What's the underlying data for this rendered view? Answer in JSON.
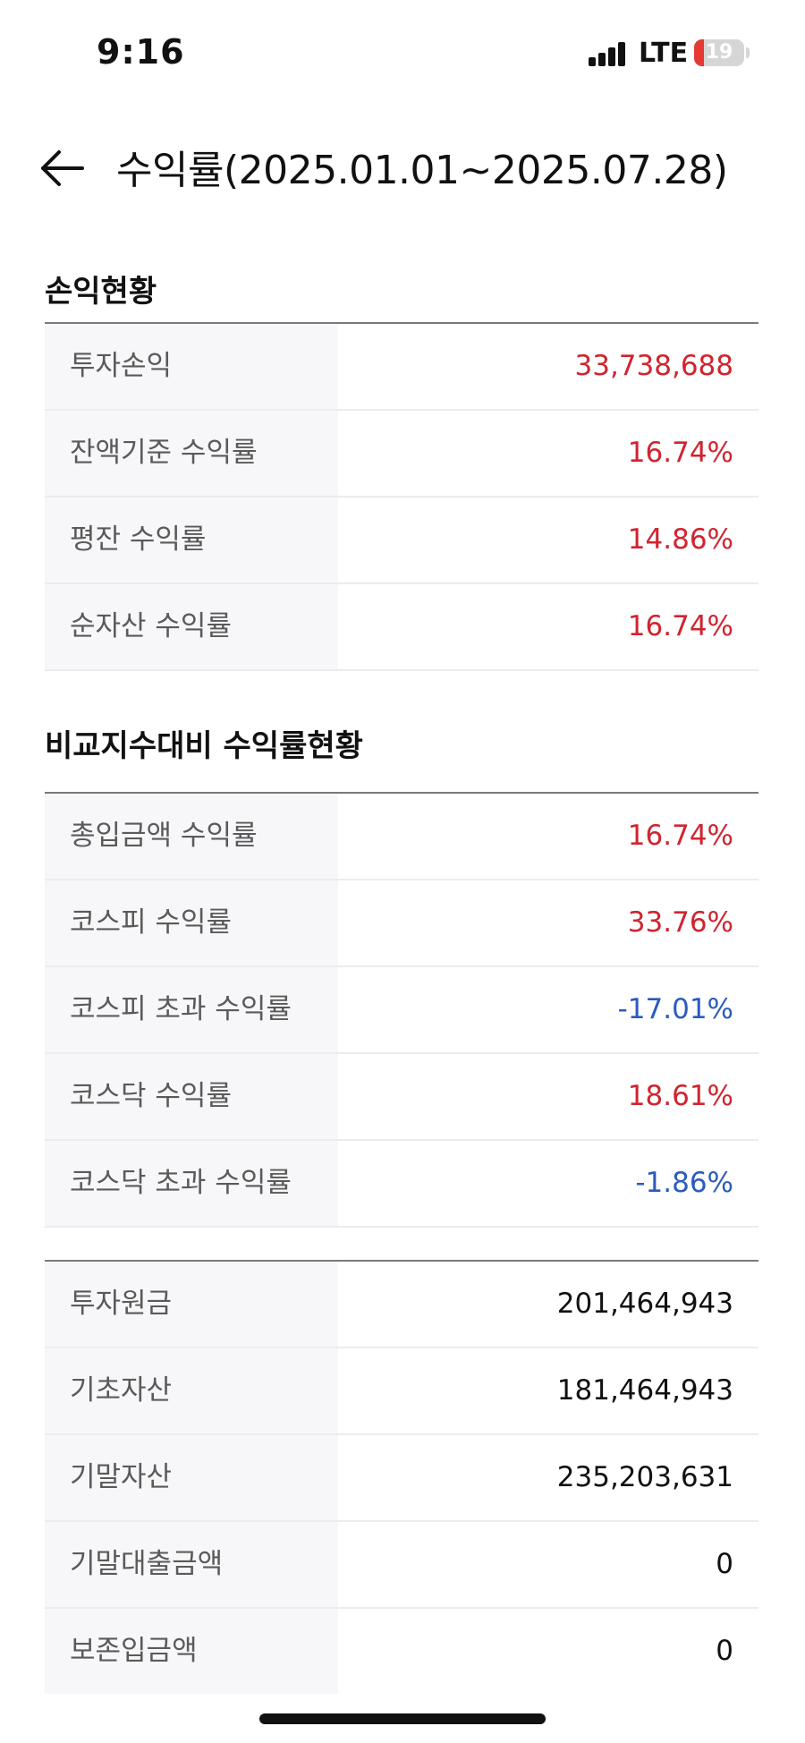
{
  "status_bar": {
    "time": "9:16",
    "network": "LTE",
    "battery": "19",
    "battery_level": 0.19
  },
  "header": {
    "title": "수익률(2025.01.01~2025.07.28)",
    "back_icon": "arrow-left-icon"
  },
  "pnl_section": {
    "title": "손익현황",
    "rows": [
      {
        "label": "투자손익",
        "value": "33,738,688",
        "color": "#d0242f"
      },
      {
        "label": "잔액기준 수익률",
        "value": "16.74%",
        "color": "#d0242f"
      },
      {
        "label": "평잔 수익률",
        "value": "14.86%",
        "color": "#d0242f"
      },
      {
        "label": "순자산 수익률",
        "value": "16.74%",
        "color": "#d0242f"
      }
    ]
  },
  "benchmark_section": {
    "title": "비교지수대비 수익률현황",
    "rows": [
      {
        "label": "총입금액 수익률",
        "value": "16.74%",
        "color": "#d0242f"
      },
      {
        "label": "코스피 수익률",
        "value": "33.76%",
        "color": "#d0242f"
      },
      {
        "label": "코스피 초과 수익률",
        "value": "-17.01%",
        "color": "#2a5bbd"
      },
      {
        "label": "코스닥 수익률",
        "value": "18.61%",
        "color": "#d0242f"
      },
      {
        "label": "코스닥 초과 수익률",
        "value": "-1.86%",
        "color": "#2a5bbd"
      }
    ]
  },
  "asset_section": {
    "rows": [
      {
        "label": "투자원금",
        "value": "201,464,943",
        "color": "#111111"
      },
      {
        "label": "기초자산",
        "value": "181,464,943",
        "color": "#111111"
      },
      {
        "label": "기말자산",
        "value": "235,203,631",
        "color": "#111111"
      },
      {
        "label": "기말대출금액",
        "value": "0",
        "color": "#111111"
      },
      {
        "label": "보존입금액",
        "value": "0",
        "color": "#111111"
      }
    ]
  }
}
